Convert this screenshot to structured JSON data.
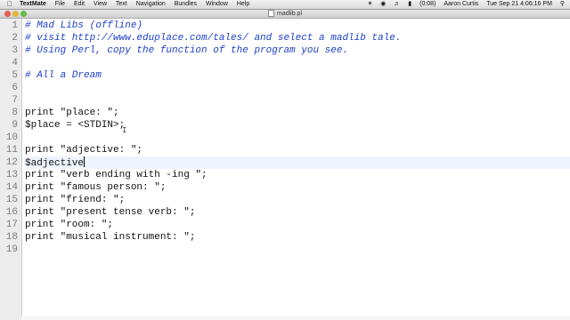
{
  "menubar": {
    "apple_icon": "apple-icon",
    "items": [
      "TextMate",
      "File",
      "Edit",
      "View",
      "Text",
      "Navigation",
      "Bundles",
      "Window",
      "Help"
    ],
    "battery": "(0:08)",
    "user": "Aaron Curtis",
    "clock": "Tue Sep 21  4:06:16 PM"
  },
  "window": {
    "title": "madlib.pl"
  },
  "editor": {
    "lines": [
      {
        "n": "1",
        "text": "# Mad Libs (offline)",
        "type": "comment"
      },
      {
        "n": "2",
        "text": "# visit http://www.eduplace.com/tales/ and select a madlib tale.",
        "type": "comment"
      },
      {
        "n": "3",
        "text": "# Using Perl, copy the function of the program you see.",
        "type": "comment"
      },
      {
        "n": "4",
        "text": "",
        "type": "code"
      },
      {
        "n": "5",
        "text": "# All a Dream",
        "type": "comment"
      },
      {
        "n": "6",
        "text": "",
        "type": "code"
      },
      {
        "n": "7",
        "text": "",
        "type": "code"
      },
      {
        "n": "8",
        "text": "print \"place: \";",
        "type": "code"
      },
      {
        "n": "9",
        "text": "$place = <STDIN>;",
        "type": "code"
      },
      {
        "n": "10",
        "text": "",
        "type": "code"
      },
      {
        "n": "11",
        "text": "print \"adjective: \";",
        "type": "code"
      },
      {
        "n": "12",
        "text": "$adjective",
        "type": "code",
        "current": true
      },
      {
        "n": "13",
        "text": "print \"verb ending with -ing \";",
        "type": "code"
      },
      {
        "n": "14",
        "text": "print \"famous person: \";",
        "type": "code"
      },
      {
        "n": "15",
        "text": "print \"friend: \";",
        "type": "code"
      },
      {
        "n": "16",
        "text": "print \"present tense verb: \";",
        "type": "code"
      },
      {
        "n": "17",
        "text": "print \"room: \";",
        "type": "code"
      },
      {
        "n": "18",
        "text": "print \"musical instrument: \";",
        "type": "code"
      },
      {
        "n": "19",
        "text": "",
        "type": "code"
      }
    ]
  },
  "colors": {
    "comment": "#1b3fc9",
    "current_line": "#eef3ff",
    "gutter": "#ececec"
  }
}
